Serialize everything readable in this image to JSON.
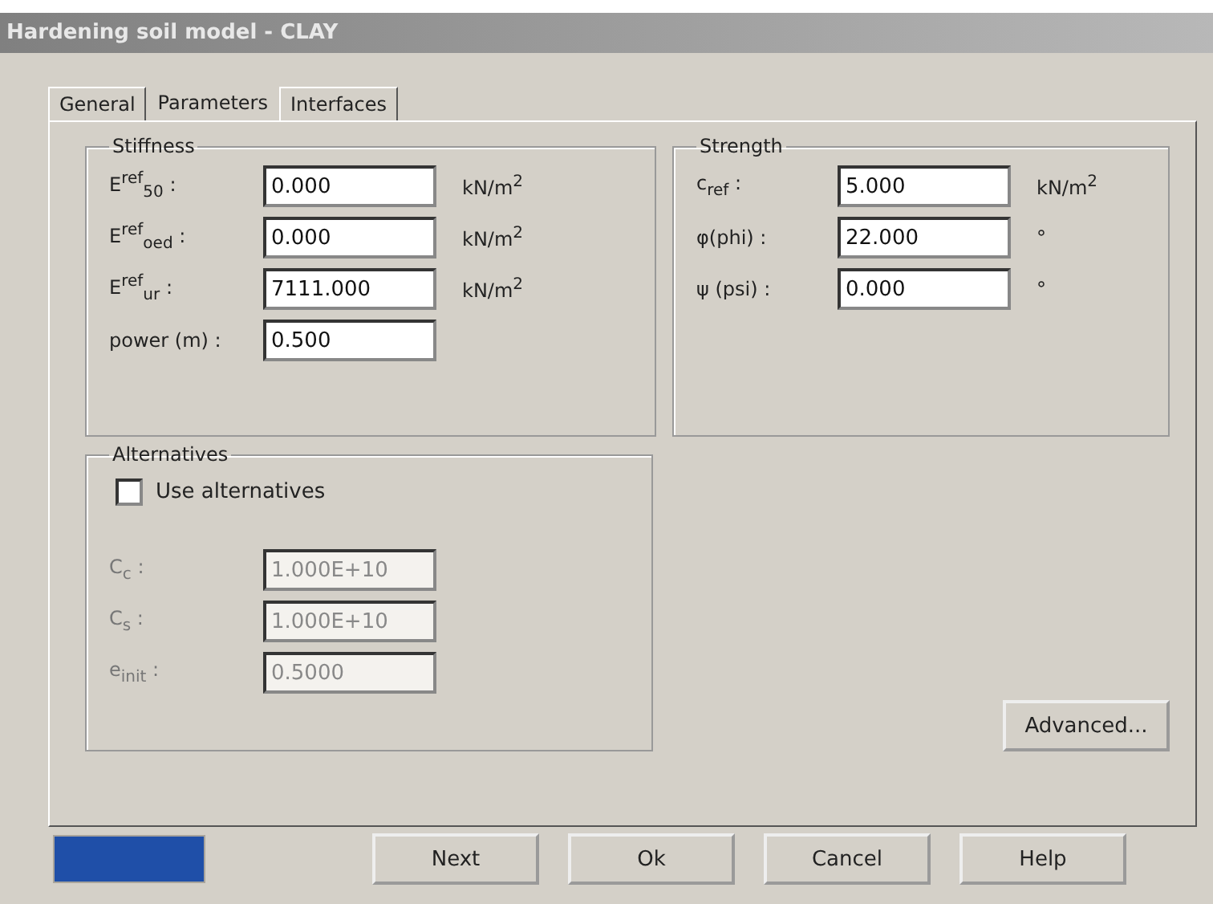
{
  "window": {
    "title": "Hardening soil model - CLAY"
  },
  "tabs": [
    {
      "label": "General",
      "selected": false
    },
    {
      "label": "Parameters",
      "selected": true
    },
    {
      "label": "Interfaces",
      "selected": false
    }
  ],
  "stiffness": {
    "title": "Stiffness",
    "rows": [
      {
        "label": "E$^{ref}$$_{50}$ :",
        "value": "0.000",
        "unit": "kN/m$^{2}$"
      },
      {
        "label": "E$^{ref}$$_{oed}$ :",
        "value": "0.000",
        "unit": "kN/m$^{2}$"
      },
      {
        "label": "E$^{ref}$$_{ur}$ :",
        "value": "7111.000",
        "unit": "kN/m$^{2}$"
      },
      {
        "label": "power (m) :",
        "value": "0.500"
      }
    ]
  },
  "strength": {
    "title": "Strength",
    "rows": [
      {
        "label": "c$_{ref}$ :",
        "value": "5.000",
        "unit": "kN/m$^{2}$"
      },
      {
        "label": "φ(phi) :",
        "value": "22.000",
        "unit": "°"
      },
      {
        "label": "ψ (psi) :",
        "value": "0.000",
        "unit": "°"
      }
    ]
  },
  "alternatives": {
    "title": "Alternatives",
    "checkbox": {
      "label": "Use alternatives",
      "checked": false
    },
    "rows": [
      {
        "label": "C$_{c}$ :",
        "value": "1.000E+10",
        "disabled": true
      },
      {
        "label": "C$_{s}$ :",
        "value": "1.000E+10",
        "disabled": true
      },
      {
        "label": "e$_{init}$ :",
        "value": "0.5000",
        "disabled": true
      }
    ]
  },
  "progress": {
    "level": 1
  },
  "advanced_button": "Advanced...",
  "buttons": [
    "Next",
    "Ok",
    "Cancel",
    "Help"
  ]
}
